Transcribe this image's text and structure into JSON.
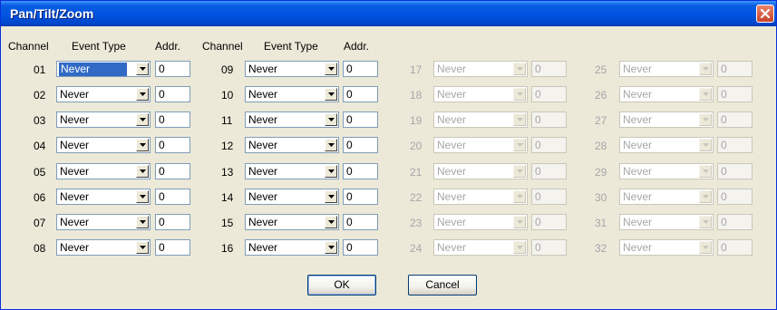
{
  "window": {
    "title": "Pan/Tilt/Zoom"
  },
  "headers": {
    "channel": "Channel",
    "event_type": "Event Type",
    "addr": "Addr."
  },
  "columns": [
    {
      "enabled": true,
      "rows": [
        {
          "channel": "01",
          "event": "Never",
          "addr": "0",
          "selected": true
        },
        {
          "channel": "02",
          "event": "Never",
          "addr": "0"
        },
        {
          "channel": "03",
          "event": "Never",
          "addr": "0"
        },
        {
          "channel": "04",
          "event": "Never",
          "addr": "0"
        },
        {
          "channel": "05",
          "event": "Never",
          "addr": "0"
        },
        {
          "channel": "06",
          "event": "Never",
          "addr": "0"
        },
        {
          "channel": "07",
          "event": "Never",
          "addr": "0"
        },
        {
          "channel": "08",
          "event": "Never",
          "addr": "0"
        }
      ]
    },
    {
      "enabled": true,
      "rows": [
        {
          "channel": "09",
          "event": "Never",
          "addr": "0"
        },
        {
          "channel": "10",
          "event": "Never",
          "addr": "0"
        },
        {
          "channel": "11",
          "event": "Never",
          "addr": "0"
        },
        {
          "channel": "12",
          "event": "Never",
          "addr": "0"
        },
        {
          "channel": "13",
          "event": "Never",
          "addr": "0"
        },
        {
          "channel": "14",
          "event": "Never",
          "addr": "0"
        },
        {
          "channel": "15",
          "event": "Never",
          "addr": "0"
        },
        {
          "channel": "16",
          "event": "Never",
          "addr": "0"
        }
      ]
    },
    {
      "enabled": false,
      "rows": [
        {
          "channel": "17",
          "event": "Never",
          "addr": "0"
        },
        {
          "channel": "18",
          "event": "Never",
          "addr": "0"
        },
        {
          "channel": "19",
          "event": "Never",
          "addr": "0"
        },
        {
          "channel": "20",
          "event": "Never",
          "addr": "0"
        },
        {
          "channel": "21",
          "event": "Never",
          "addr": "0"
        },
        {
          "channel": "22",
          "event": "Never",
          "addr": "0"
        },
        {
          "channel": "23",
          "event": "Never",
          "addr": "0"
        },
        {
          "channel": "24",
          "event": "Never",
          "addr": "0"
        }
      ]
    },
    {
      "enabled": false,
      "rows": [
        {
          "channel": "25",
          "event": "Never",
          "addr": "0"
        },
        {
          "channel": "26",
          "event": "Never",
          "addr": "0"
        },
        {
          "channel": "27",
          "event": "Never",
          "addr": "0"
        },
        {
          "channel": "28",
          "event": "Never",
          "addr": "0"
        },
        {
          "channel": "29",
          "event": "Never",
          "addr": "0"
        },
        {
          "channel": "30",
          "event": "Never",
          "addr": "0"
        },
        {
          "channel": "31",
          "event": "Never",
          "addr": "0"
        },
        {
          "channel": "32",
          "event": "Never",
          "addr": "0"
        }
      ]
    }
  ],
  "buttons": {
    "ok": "OK",
    "cancel": "Cancel"
  },
  "colors": {
    "titlebar": "#0054e3",
    "dialog_bg": "#ece9d8",
    "selection": "#316ac5",
    "disabled_text": "#a7a6aa"
  }
}
